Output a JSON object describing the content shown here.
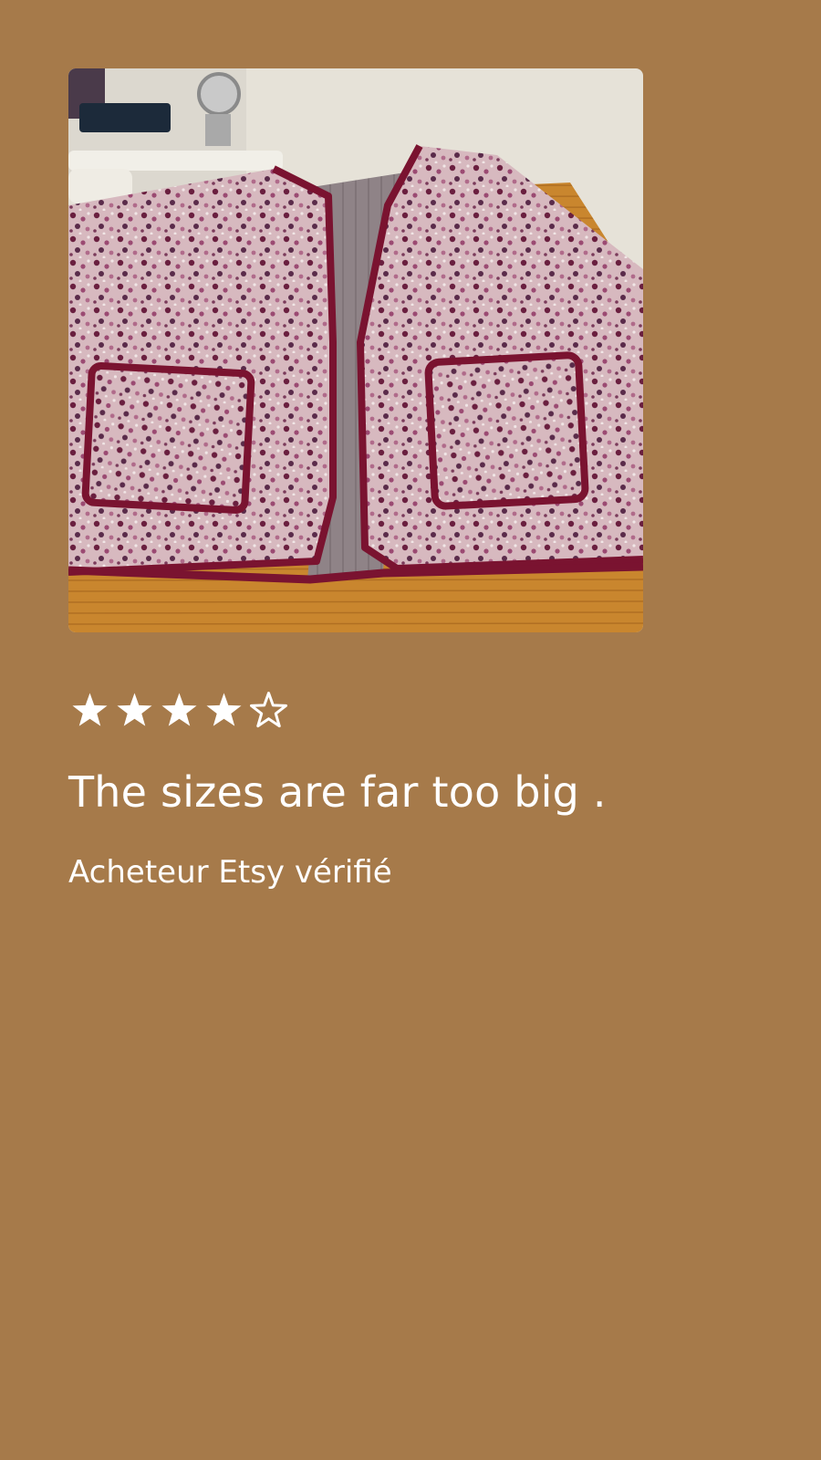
{
  "colors": {
    "background": "#a67a4a",
    "text": "#ffffff",
    "jacket_binding": "#7a1330",
    "jacket_fabric": "#c9a3ad",
    "lining": "#8f8387",
    "table_wood": "#c9862e",
    "wall": "#e9e6de"
  },
  "review": {
    "photo_alt": "Quilted floral jacket laid on a wooden table",
    "rating": 4,
    "max_rating": 5,
    "title": "The sizes are far too big .",
    "reviewer": "Acheteur Etsy vérifié"
  }
}
